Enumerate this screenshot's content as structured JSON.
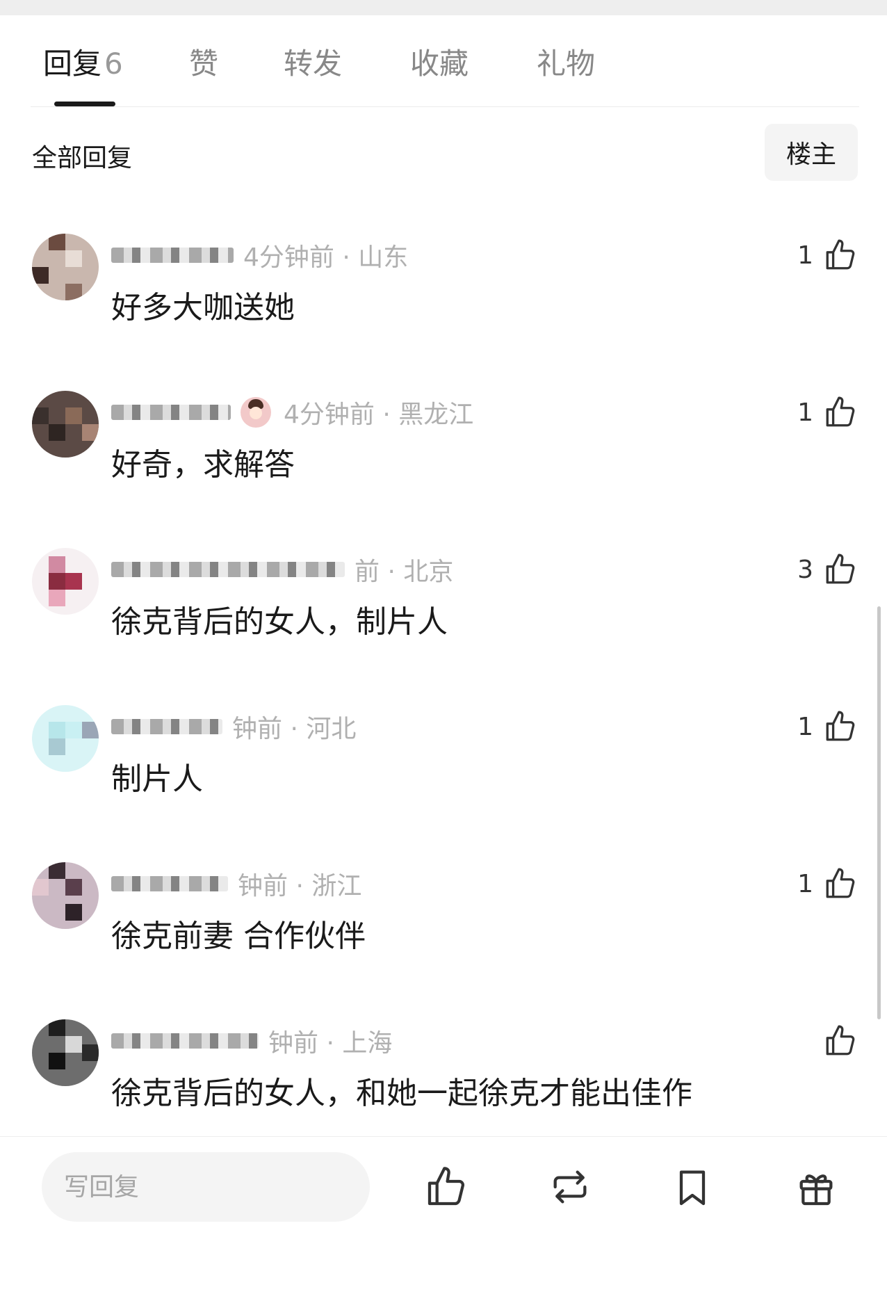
{
  "tabs": [
    {
      "label": "回复",
      "count": "6"
    },
    {
      "label": "赞"
    },
    {
      "label": "转发"
    },
    {
      "label": "收藏"
    },
    {
      "label": "礼物"
    }
  ],
  "filter": {
    "title": "全部回复",
    "op_button": "楼主"
  },
  "comments": [
    {
      "meta": "4分钟前 · 山东",
      "text": "好多大咖送她",
      "likes": "1"
    },
    {
      "meta": "4分钟前 · 黑龙江",
      "text": "好奇，求解答",
      "likes": "1"
    },
    {
      "meta": "前 · 北京",
      "text": "徐克背后的女人，制片人",
      "likes": "3"
    },
    {
      "meta": "钟前 · 河北",
      "text": "制片人",
      "likes": "1"
    },
    {
      "meta": "钟前 · 浙江",
      "text": "徐克前妻 合作伙伴",
      "likes": "1"
    },
    {
      "meta": "钟前 · 上海",
      "text": "徐克背后的女人，和她一起徐克才能出佳作",
      "likes": ""
    }
  ],
  "bottom_bar": {
    "reply_placeholder": "写回复",
    "icons": [
      "thumbs-up-icon",
      "repost-icon",
      "bookmark-icon",
      "gift-icon"
    ]
  },
  "colors": {
    "text_primary": "#1a1a1a",
    "text_meta": "#b0b0b0",
    "tab_inactive": "#888888",
    "input_bg": "#f4f4f4"
  }
}
